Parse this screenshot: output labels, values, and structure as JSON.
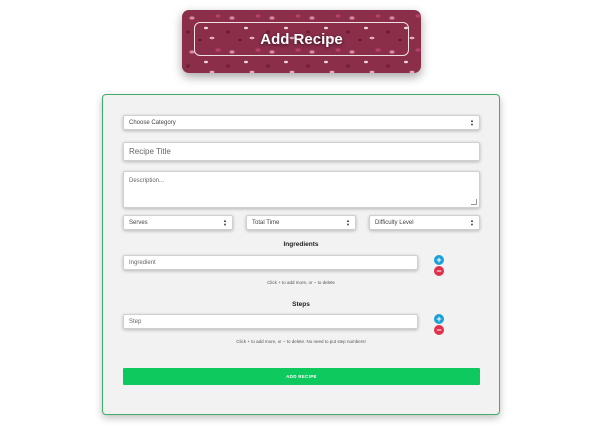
{
  "header": {
    "title": "Add Recipe"
  },
  "form": {
    "category": {
      "selected": "Choose Category"
    },
    "recipe_title": {
      "placeholder": "Recipe Title"
    },
    "description": {
      "placeholder": "Description..."
    },
    "serves": {
      "selected": "Serves"
    },
    "total_time": {
      "selected": "Total Time"
    },
    "difficulty": {
      "selected": "Difficulty Level"
    },
    "ingredients": {
      "heading": "Ingredients",
      "placeholder": "Ingredient",
      "hint": "Click + to add more, or − to delete"
    },
    "steps": {
      "heading": "Steps",
      "placeholder": "Step",
      "hint": "Click + to add more, or − to delete. No need to put step numbers!"
    },
    "add_label": "+",
    "remove_label": "−",
    "submit_label": "ADD RECIPE"
  },
  "colors": {
    "card_border": "#3fae6a",
    "submit_bg": "#0ec95e",
    "add_button": "#1aa0d8",
    "remove_button": "#e0314b"
  }
}
